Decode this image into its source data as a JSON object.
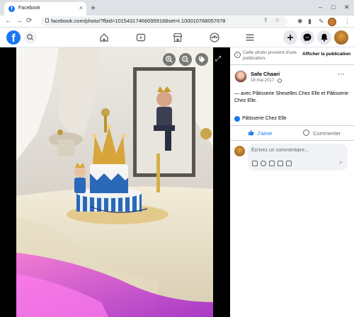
{
  "browser": {
    "tab_title": "Facebook",
    "tab_close": "×",
    "new_tab": "+",
    "url": "facebook.com/photo/?fbid=101543174660959168set=t.100010768057678",
    "window_controls": [
      "–",
      "□",
      "✕"
    ]
  },
  "fb_header": {
    "logo_letter": "f",
    "icons": [
      "search-icon",
      "home-icon",
      "watch-icon",
      "marketplace-icon",
      "groups-icon",
      "menu-icon",
      "create-icon",
      "messenger-icon",
      "notifications-icon"
    ],
    "brand_color": "#1877f2"
  },
  "panel": {
    "info_text": "Cette photo provient d'une publication.",
    "show_post": "Afficher la publication",
    "author_name": "Safa Chaari",
    "post_date": "18 mai 2017 ·",
    "more": "···",
    "caption": "— avec Pâtisserie Sheselles Chez Elle et Pâtisserie Chez Elle.",
    "tagged_page": "Pâtisserie Chez Elle",
    "like_label": "J'aime",
    "comment_label": "Commenter",
    "comment_placeholder": "Écrivez un commentaire…",
    "send": "➤"
  }
}
